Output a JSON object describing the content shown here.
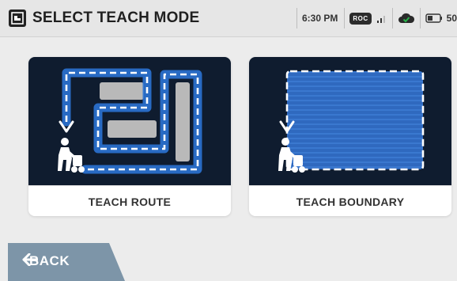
{
  "header": {
    "title": "SELECT TEACH MODE",
    "time": "6:30 PM",
    "roc_badge": "ROC",
    "battery": "50"
  },
  "cards": {
    "route": {
      "label": "TEACH ROUTE"
    },
    "boundary": {
      "label": "TEACH BOUNDARY"
    }
  },
  "nav": {
    "back_label": "BACK"
  },
  "colors": {
    "accent": "#1e8fff",
    "card_art_background": "#0f1c2f",
    "boundary_fill": "#2c64b8",
    "back_button": "#7d95a8"
  },
  "icons": {
    "app": "app-logo-icon",
    "signal": "signal-bars-icon",
    "cloud": "cloud-check-icon",
    "battery": "battery-icon",
    "back": "arrow-left-icon"
  }
}
